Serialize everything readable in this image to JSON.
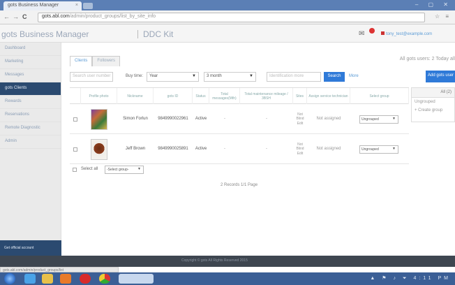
{
  "browser": {
    "tab_title": "gots Business Manager",
    "tab_close": "×",
    "url_host": "gots.abl.com",
    "url_path": "/admin/product_groups/list_by_site_info",
    "nav_back": "←",
    "nav_forward": "→",
    "nav_reload": "C",
    "window_controls": "– ▢ ✕",
    "toolbar_icons": "☆ ≡"
  },
  "header": {
    "app_title": "gots Business Manager",
    "org_name": "DDC Kit",
    "mail_icon": "✉",
    "user_email": "tony_test@example.com"
  },
  "sidebar": {
    "items": [
      {
        "label": "Dashboard"
      },
      {
        "label": "Marketing"
      },
      {
        "label": "Messages"
      },
      {
        "label": "gots Clients"
      },
      {
        "label": "Rewards"
      },
      {
        "label": "Reservations"
      },
      {
        "label": "Remote Diagnostic"
      },
      {
        "label": "Admin"
      }
    ],
    "bottom_label": "Get official account"
  },
  "main": {
    "tabs": [
      {
        "label": "Clients"
      },
      {
        "label": "Followers"
      }
    ],
    "top_right_text": "All gots users: 2    Today all",
    "toolbar": {
      "search_placeholder": "Search user number",
      "buy_time_label": "Buy time:",
      "time_value": "Year",
      "period_value": "3 month",
      "keyword_placeholder": "Identification more",
      "search_label": "Search",
      "more_label": "More",
      "add_label": "Add gots user"
    },
    "columns": [
      "",
      "Profile photo",
      "Nickname",
      "gots ID",
      "Status",
      "Total messages(Mth)",
      "Total maintenance mileage / 3BSH",
      "Sites",
      "Assign service technician",
      "Select group"
    ],
    "rows": [
      {
        "nickname": "Simon Forlun",
        "gots_id": "9849990022961",
        "status": "Active",
        "messages": "-",
        "maintenance": "-",
        "sites": "Not Blind Edit",
        "technician": "Not assigned",
        "group": "Ungrouped"
      },
      {
        "nickname": "Jeff Brown",
        "gots_id": "9849990025891",
        "status": "Active",
        "messages": "-",
        "maintenance": "-",
        "sites": "Not Blind Edit",
        "technician": "Not assigned",
        "group": "Ungrouped"
      }
    ],
    "select_all_label": "Select all",
    "bulk_group_value": "-Select group-",
    "pager_text": "2 Records 1/1 Page"
  },
  "right_panel": {
    "header": "All (2)",
    "items": [
      {
        "label": "Ungrouped"
      },
      {
        "label": "+ Create group"
      }
    ]
  },
  "footer": {
    "text": "Copyright © gots All Rights Reserved 2015"
  },
  "status_url": "gots.abl.com/admin/product_groups/list",
  "taskbar": {
    "tray_text": "▲ ⚑ ♪ ⏷ 4:11 PM"
  }
}
